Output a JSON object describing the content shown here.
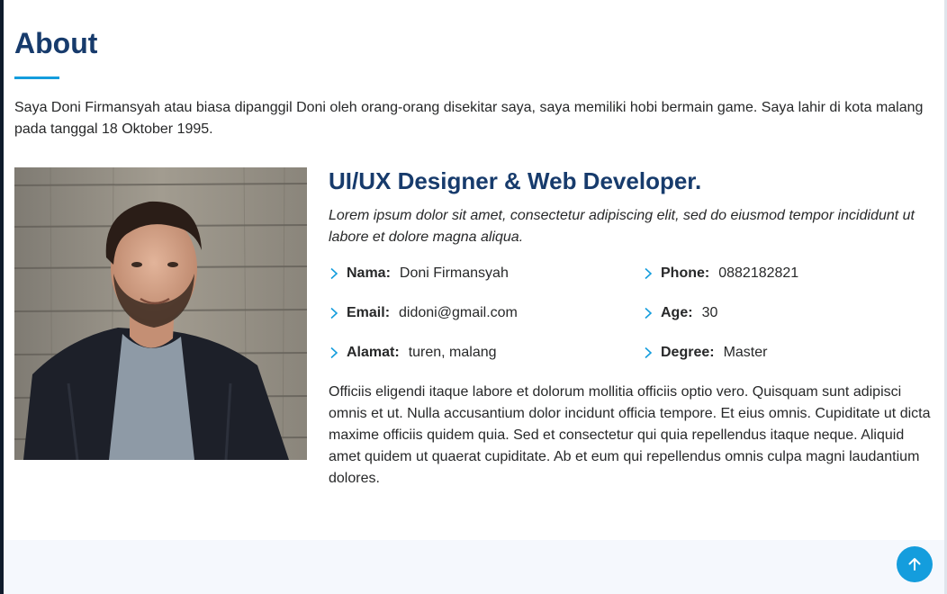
{
  "about": {
    "title": "About",
    "intro": "Saya Doni Firmansyah atau biasa dipanggil Doni oleh orang-orang disekitar saya, saya memiliki hobi bermain game. Saya lahir di kota malang pada tanggal 18 Oktober 1995.",
    "role_title": "UI/UX Designer & Web Developer.",
    "tagline": "Lorem ipsum dolor sit amet, consectetur adipiscing elit, sed do eiusmod tempor incididunt ut labore et dolore magna aliqua.",
    "details": [
      {
        "key": "Nama:",
        "value": "Doni Firmansyah"
      },
      {
        "key": "Phone:",
        "value": "0882182821"
      },
      {
        "key": "Email:",
        "value": "didoni@gmail.com"
      },
      {
        "key": "Age:",
        "value": "30"
      },
      {
        "key": "Alamat:",
        "value": "turen, malang"
      },
      {
        "key": "Degree:",
        "value": "Master"
      }
    ],
    "body": "Officiis eligendi itaque labore et dolorum mollitia officiis optio vero. Quisquam sunt adipisci omnis et ut. Nulla accusantium dolor incidunt officia tempore. Et eius omnis. Cupiditate ut dicta maxime officiis quidem quia. Sed et consectetur qui quia repellendus itaque neque. Aliquid amet quidem ut quaerat cupiditate. Ab et eum qui repellendus omnis culpa magni laudantium dolores."
  },
  "icons": {
    "detail_bullet": "chevron-right-icon",
    "back_to_top": "arrow-up-icon"
  },
  "colors": {
    "heading": "#173b6c",
    "accent": "#149ddd",
    "text": "#272829",
    "footer_bg": "#f5f8fd"
  }
}
